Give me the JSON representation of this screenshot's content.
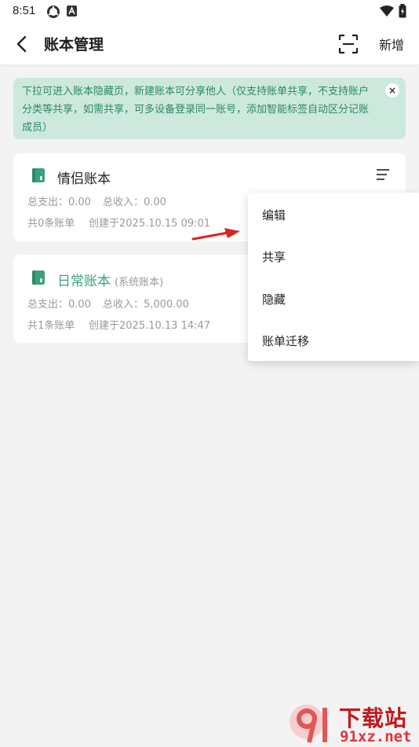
{
  "status_bar": {
    "time": "8:51"
  },
  "header": {
    "title": "账本管理",
    "add_label": "新增"
  },
  "notice": {
    "text": "下拉可进入账本隐藏页，新建账本可分享他人（仅支持账单共享，不支持账户分类等共享，如需共享，可多设备登录同一账号，添加智能标签自动区分记账成员）"
  },
  "books": [
    {
      "name": "情侣账本",
      "tag": "",
      "expense": "总支出：0.00",
      "income": "总收入：0.00",
      "count": "共0条账单",
      "created": "创建于2025.10.15 09:01"
    },
    {
      "name": "日常账本",
      "tag": "(系统账本)",
      "expense": "总支出：0.00",
      "income": "总收入：5,000.00",
      "count": "共1条账单",
      "created": "创建于2025.10.13 14:47"
    }
  ],
  "menu": {
    "items": [
      "编辑",
      "共享",
      "隐藏",
      "账单迁移"
    ]
  },
  "watermark": {
    "line1": "下载站",
    "line2": "91xz.net"
  },
  "colors": {
    "accent": "#3aa27b",
    "notice_bg": "#cde8dd",
    "watermark_red": "#c3171c"
  }
}
